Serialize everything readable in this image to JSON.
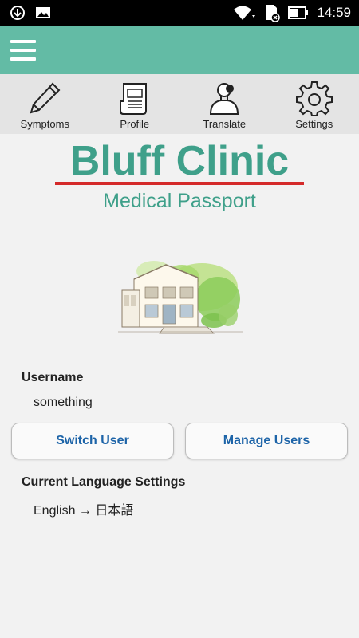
{
  "status_bar": {
    "time": "14:59",
    "icons": [
      "download-icon",
      "image-icon",
      "wifi-icon",
      "sd-card-icon",
      "battery-icon"
    ]
  },
  "app_bar": {
    "menu_icon": "hamburger-menu-icon",
    "color": "#63bba5"
  },
  "tabs": [
    {
      "label": "Symptoms",
      "icon": "pencil-icon"
    },
    {
      "label": "Profile",
      "icon": "document-icon"
    },
    {
      "label": "Translate",
      "icon": "person-speaking-icon"
    },
    {
      "label": "Settings",
      "icon": "gear-icon"
    }
  ],
  "logo": {
    "title": "Bluff Clinic",
    "subtitle": "Medical Passport",
    "title_color": "#3fa08a",
    "rule_color": "#d42a2a"
  },
  "user": {
    "username_label": "Username",
    "username_value": "something",
    "switch_user_label": "Switch User",
    "manage_users_label": "Manage Users"
  },
  "language": {
    "label": "Current Language Settings",
    "value": "English → 日本語"
  },
  "colors": {
    "accent": "#63bba5",
    "button_text": "#1d64a8",
    "background": "#f2f2f2"
  }
}
